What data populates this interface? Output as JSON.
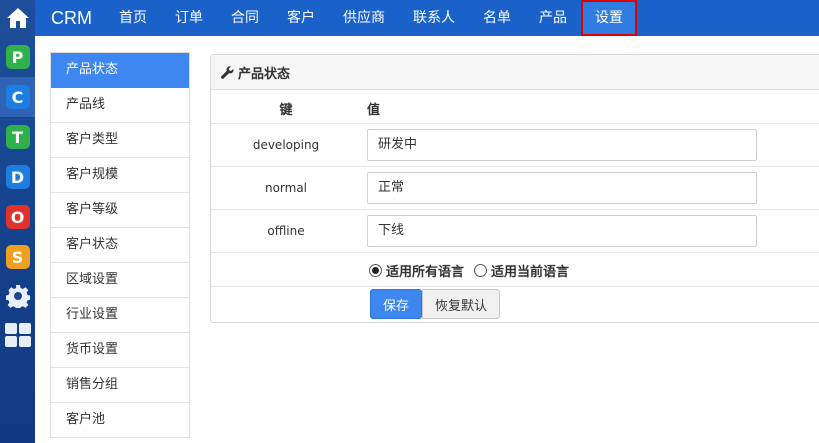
{
  "colors": {
    "topnav": "#1a62c9",
    "dock": "#1f4f9a",
    "accent": "#3e86f0",
    "highlight_border": "#e00000"
  },
  "dock": {
    "items": [
      {
        "icon": "home-icon",
        "glyph": ""
      },
      {
        "icon": "app-p-icon",
        "glyph": "P",
        "color": "#2fb24c"
      },
      {
        "icon": "app-c-icon",
        "glyph": "C",
        "color": "#1b7ee0"
      },
      {
        "icon": "app-t-icon",
        "glyph": "T",
        "color": "#2fb24c"
      },
      {
        "icon": "app-d-icon",
        "glyph": "D",
        "color": "#1b7ee0"
      },
      {
        "icon": "app-o-icon",
        "glyph": "O",
        "color": "#e0322b"
      },
      {
        "icon": "app-s-icon",
        "glyph": "S",
        "color": "#f0a020"
      },
      {
        "icon": "gear-icon",
        "glyph": ""
      },
      {
        "icon": "grid-icon",
        "glyph": ""
      }
    ]
  },
  "topnav": {
    "brand": "CRM",
    "items": [
      "首页",
      "订单",
      "合同",
      "客户",
      "供应商",
      "联系人",
      "名单",
      "产品",
      "设置"
    ]
  },
  "leftmenu": {
    "items": [
      "产品状态",
      "产品线",
      "客户类型",
      "客户规模",
      "客户等级",
      "客户状态",
      "区域设置",
      "行业设置",
      "货币设置",
      "销售分组",
      "客户池"
    ]
  },
  "panel": {
    "title": "产品状态",
    "header": {
      "key": "键",
      "value": "值"
    },
    "rows": [
      {
        "key": "developing",
        "value": "研发中"
      },
      {
        "key": "normal",
        "value": "正常"
      },
      {
        "key": "offline",
        "value": "下线"
      }
    ],
    "radios": [
      {
        "label": "适用所有语言",
        "checked": true
      },
      {
        "label": "适用当前语言",
        "checked": false
      }
    ],
    "save_label": "保存",
    "reset_label": "恢复默认"
  }
}
